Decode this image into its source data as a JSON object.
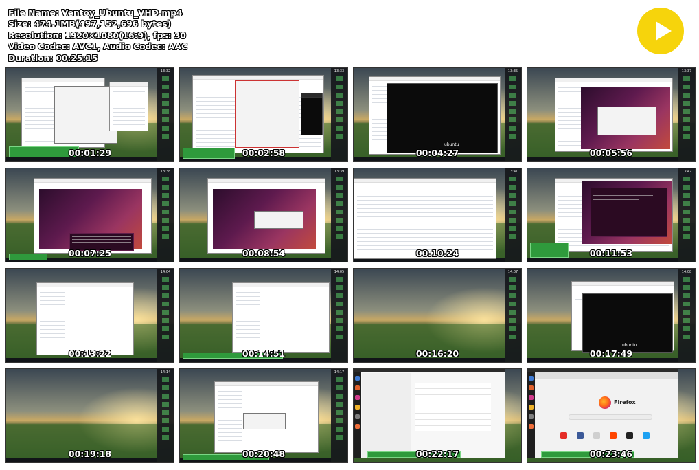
{
  "meta": {
    "file_name": "File Name: Ventoy_Ubuntu_VHD.mp4",
    "size": "Size: 474.1MB(497,152,696 bytes)",
    "resolution": "Resolution: 1920×1080(16:9), fps: 30",
    "codec": "Video Codec: AVC1, Audio Codec: AAC",
    "duration": "Duration: 00:25:15"
  },
  "logo": {
    "icon": "play-icon",
    "color": "#f6d40c"
  },
  "thumbnails": [
    {
      "time": "00:01:29",
      "clock": "13:32"
    },
    {
      "time": "00:02:58",
      "clock": "13:33"
    },
    {
      "time": "00:04:27",
      "clock": "13:35"
    },
    {
      "time": "00:05:56",
      "clock": "13:37"
    },
    {
      "time": "00:07:25",
      "clock": "13:38"
    },
    {
      "time": "00:08:54",
      "clock": "13:39"
    },
    {
      "time": "00:10:24",
      "clock": "13:41"
    },
    {
      "time": "00:11:53",
      "clock": "13:42"
    },
    {
      "time": "00:13:22",
      "clock": "14:04"
    },
    {
      "time": "00:14:51",
      "clock": "14:05"
    },
    {
      "time": "00:16:20",
      "clock": "14:07"
    },
    {
      "time": "00:17:49",
      "clock": "14:08"
    },
    {
      "time": "00:19:18",
      "clock": "14:14"
    },
    {
      "time": "00:20:48",
      "clock": "14:17"
    },
    {
      "time": "00:22:17",
      "clock": ""
    },
    {
      "time": "00:23:46",
      "clock": ""
    }
  ],
  "screen_text": {
    "ubuntu": "ubuntu",
    "firefox": "Firefox"
  },
  "colors": {
    "subtitle_bg": "#2f9a3c",
    "ubuntu_purple": "#5e1a4e",
    "terminal": "#2b0a22"
  }
}
